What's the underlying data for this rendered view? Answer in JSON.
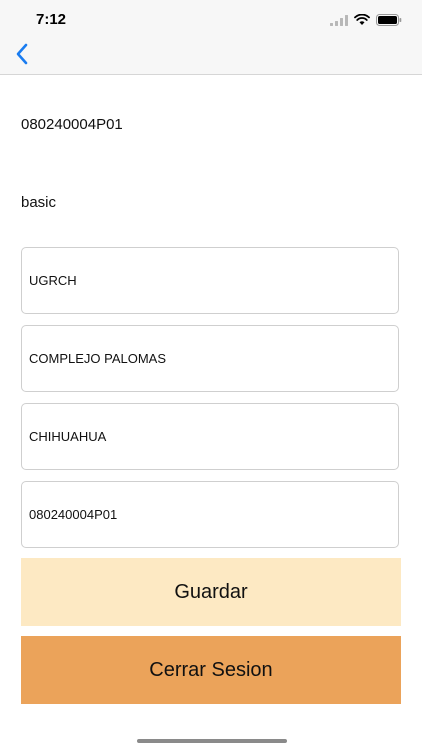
{
  "status_bar": {
    "time": "7:12",
    "icons": [
      "signal-icon",
      "wifi-icon",
      "battery-icon"
    ]
  },
  "nav": {
    "back_icon": "chevron-left-icon",
    "accent_color": "#1a7cf0"
  },
  "info": {
    "code": "080240004P01",
    "plan": "basic"
  },
  "fields": [
    {
      "value": "UGRCH"
    },
    {
      "value": "COMPLEJO PALOMAS"
    },
    {
      "value": "CHIHUAHUA"
    },
    {
      "value": "080240004P01"
    }
  ],
  "buttons": {
    "save_label": "Guardar",
    "save_color": "#fde9c3",
    "logout_label": "Cerrar Sesion",
    "logout_color": "#eba35a"
  }
}
